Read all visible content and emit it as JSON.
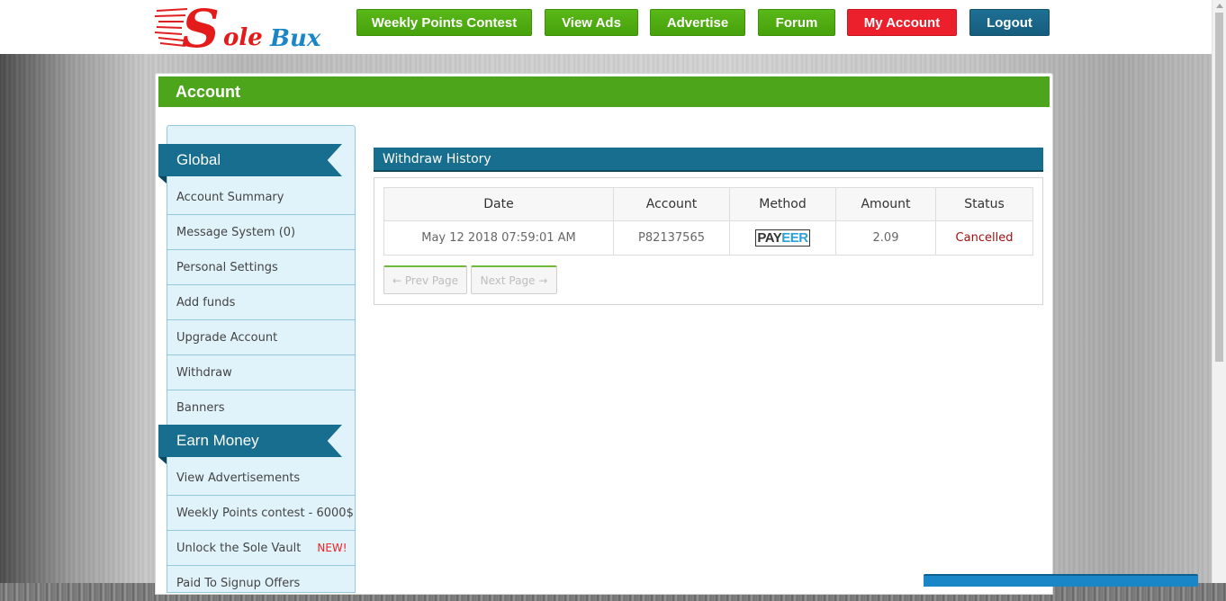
{
  "brand": {
    "logo_text_s": "S",
    "logo_text_ole": "ole",
    "logo_text_bux": "Bux"
  },
  "nav": [
    {
      "label": "Weekly Points Contest"
    },
    {
      "label": "View Ads"
    },
    {
      "label": "Advertise"
    },
    {
      "label": "Forum"
    },
    {
      "label": "My Account"
    },
    {
      "label": "Logout"
    }
  ],
  "panel": {
    "title": "Account"
  },
  "sidebar": {
    "sections": [
      {
        "title": "Global",
        "items": [
          {
            "label": "Account Summary"
          },
          {
            "label": "Message System (0)"
          },
          {
            "label": "Personal Settings"
          },
          {
            "label": "Add funds"
          },
          {
            "label": "Upgrade Account"
          },
          {
            "label": "Withdraw"
          },
          {
            "label": "Banners"
          }
        ]
      },
      {
        "title": "Earn Money",
        "items": [
          {
            "label": "View Advertisements"
          },
          {
            "label": "Weekly Points contest - 6000$"
          },
          {
            "label": "Unlock the Sole Vault",
            "badge": "NEW!"
          },
          {
            "label": "Paid To Signup Offers"
          }
        ]
      }
    ]
  },
  "withdraw_history": {
    "title": "Withdraw History",
    "columns": [
      "Date",
      "Account",
      "Method",
      "Amount",
      "Status"
    ],
    "rows": [
      {
        "date": "May 12 2018 07:59:01 AM",
        "account": "P82137565",
        "method_a": "PAY",
        "method_b": "EER",
        "amount": "2.09",
        "status": "Cancelled"
      }
    ],
    "prev_label": "← Prev Page",
    "next_label": "Next Page →"
  },
  "colors": {
    "green": "#4ca51a",
    "red": "#ec1f2c",
    "blue": "#186e8f"
  }
}
